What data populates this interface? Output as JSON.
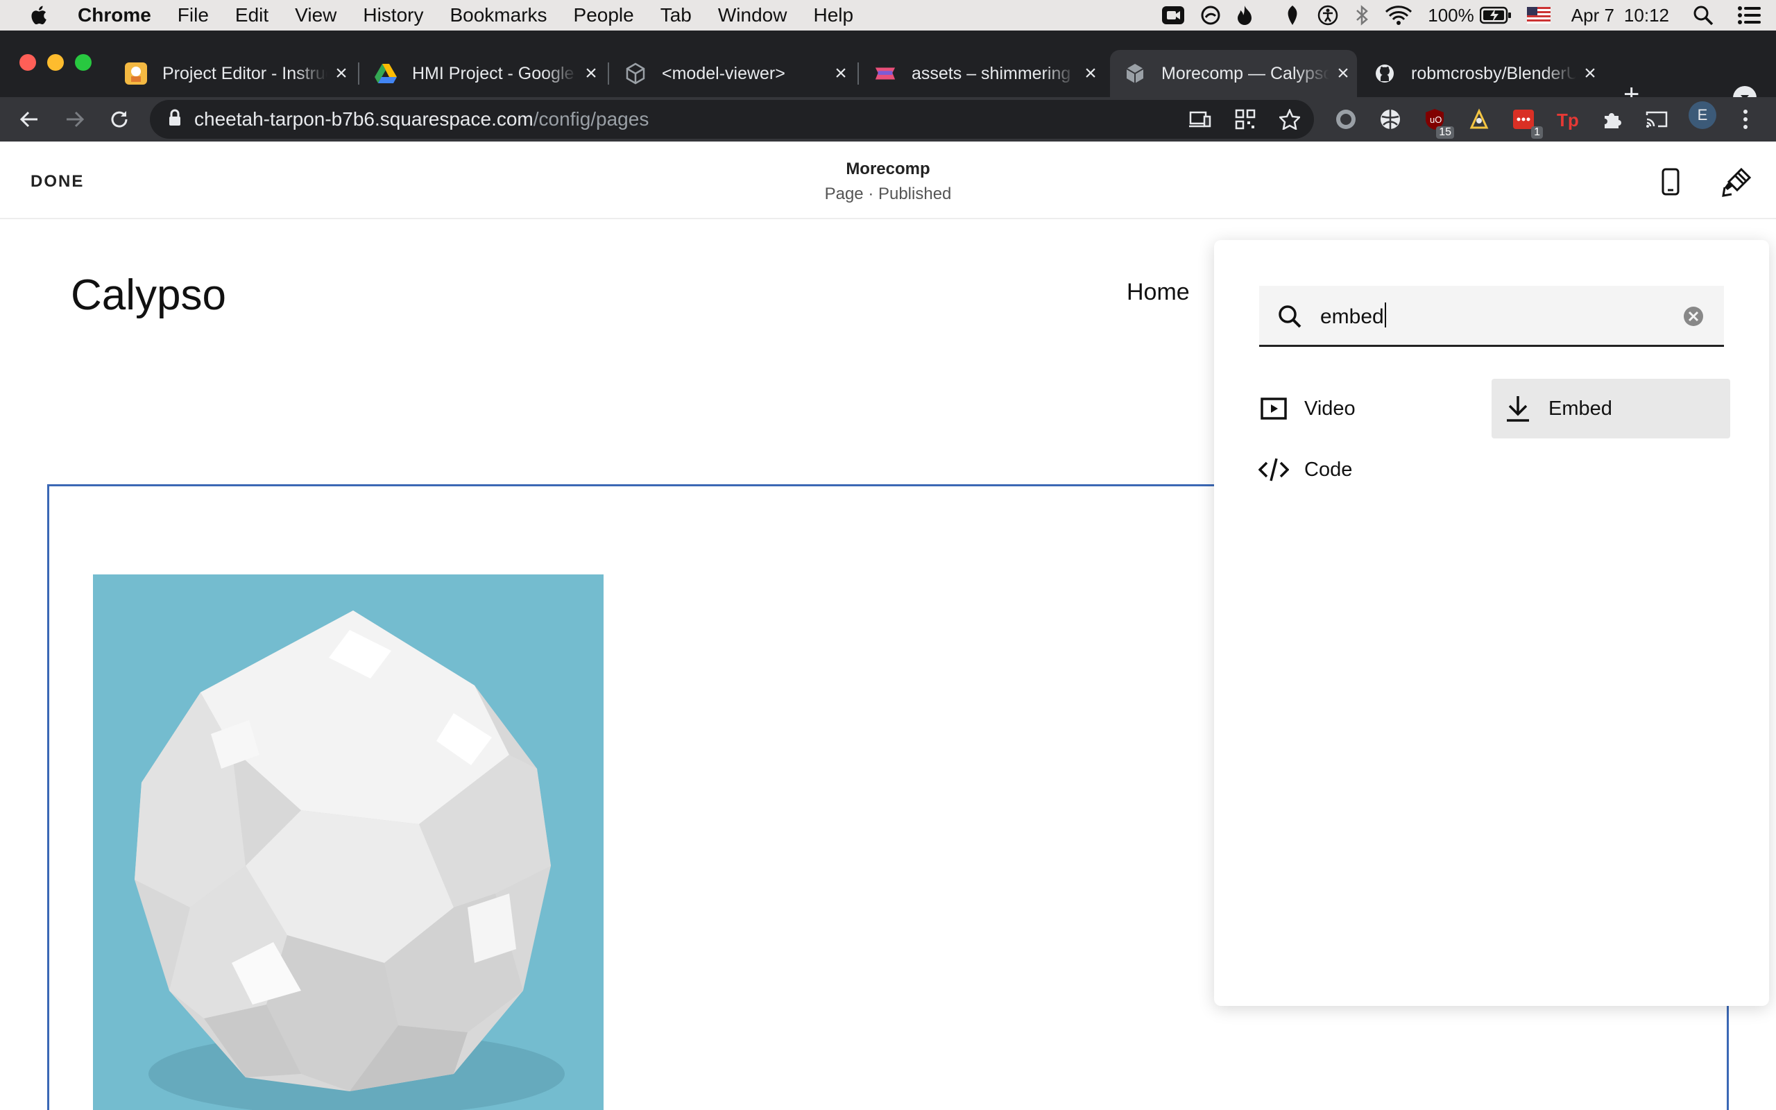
{
  "menubar": {
    "app": "Chrome",
    "items": [
      "File",
      "Edit",
      "View",
      "History",
      "Bookmarks",
      "People",
      "Tab",
      "Window",
      "Help"
    ],
    "battery": "100%",
    "date": "Apr 7",
    "time": "10:12"
  },
  "tabs": [
    {
      "title": "Project Editor - Instructables"
    },
    {
      "title": "HMI Project - Google Drive"
    },
    {
      "title": "<model-viewer>"
    },
    {
      "title": "assets – shimmering"
    },
    {
      "title": "Morecomp — Calypso"
    },
    {
      "title": "robmcrosby/BlenderUSDZ"
    }
  ],
  "address_bar": {
    "host": "cheetah-tarpon-b7b6.squarespace.com",
    "path": "/config/pages"
  },
  "extensions": {
    "badge_ublock": "15",
    "badge_todo": "1",
    "profile_initial": "E"
  },
  "editor": {
    "done_label": "DONE",
    "site_name": "Morecomp",
    "page_status": "Page · Published"
  },
  "site": {
    "title": "Calypso",
    "nav_home": "Home"
  },
  "insert_panel": {
    "search_value": "embed",
    "options": [
      {
        "label": "Video",
        "icon": "video-icon",
        "selected": false
      },
      {
        "label": "Embed",
        "icon": "download-icon",
        "selected": true
      },
      {
        "label": "Code",
        "icon": "code-icon",
        "selected": false
      }
    ]
  },
  "colors": {
    "accent_frame": "#3b68b5",
    "image_background": "#74bccf",
    "selected_option": "#e8e8e8"
  }
}
